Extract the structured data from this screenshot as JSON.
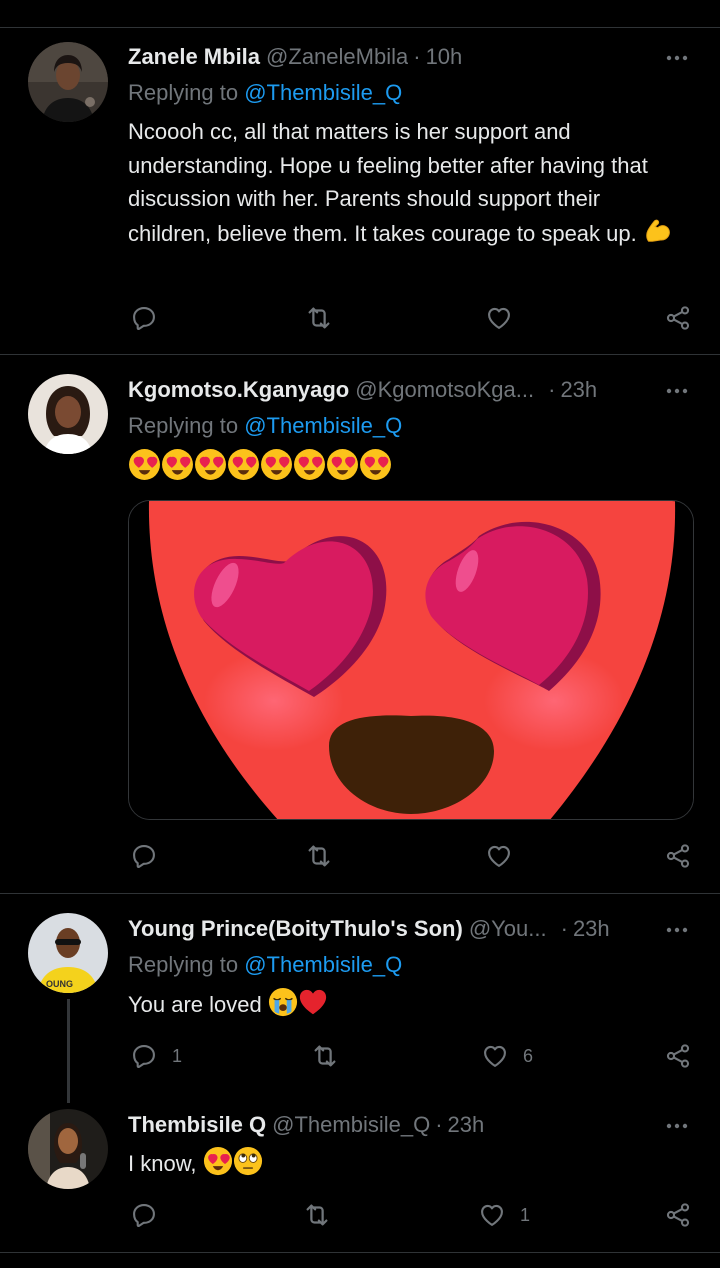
{
  "tweets": [
    {
      "name": "Zanele Mbila",
      "handle": "@ZaneleMbila",
      "separator": "·",
      "time": "10h",
      "replying_prefix": "Replying to ",
      "replying_to": "@Thembisile_Q",
      "text": "Ncoooh cc, all that matters is her support and understanding. Hope u feeling better after having that discussion with her. Parents should support their children, believe them. It takes courage to speak up.",
      "emoji": "flexed-biceps-emoji",
      "replies": "",
      "retweets": "",
      "likes": ""
    },
    {
      "name": "Kgomotso.Kganyago",
      "handle": "@KgomotsoKga...",
      "separator": "·",
      "time": "23h",
      "replying_prefix": "Replying to ",
      "replying_to": "@Thembisile_Q",
      "emoji_count": 8,
      "emoji": "heart-eyes-emoji",
      "media": "heart-eyes-emoji-closeup",
      "replies": "",
      "retweets": "",
      "likes": ""
    },
    {
      "name": "Young Prince(BoityThulo's Son)",
      "handle": "@You...",
      "separator": "·",
      "time": "23h",
      "replying_prefix": "Replying to ",
      "replying_to": "@Thembisile_Q",
      "text": "You are loved",
      "emoji": [
        "loudly-crying-emoji",
        "red-heart-emoji"
      ],
      "replies": "1",
      "retweets": "",
      "likes": "6"
    },
    {
      "name": "Thembisile Q",
      "handle": "@Thembisile_Q",
      "separator": "·",
      "time": "23h",
      "text": "I know,",
      "emoji": [
        "heart-eyes-emoji",
        "rolling-eyes-emoji"
      ],
      "replies": "",
      "retweets": "",
      "likes": "1"
    }
  ],
  "colors": {
    "background": "#000000",
    "text": "#e7e9ea",
    "secondary": "#71767b",
    "link": "#1d9bf0",
    "divider": "#2f3336"
  },
  "icons": [
    "reply-icon",
    "retweet-icon",
    "like-icon",
    "share-icon",
    "more-icon"
  ]
}
